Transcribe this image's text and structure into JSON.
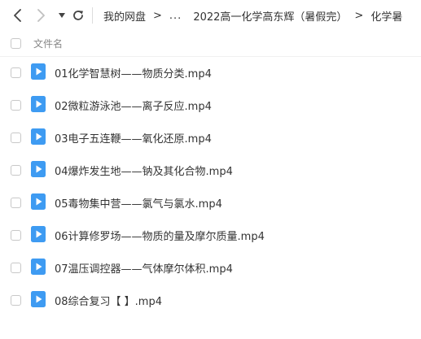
{
  "toolbar": {
    "back_icon": "chevron-left-icon",
    "forward_icon": "chevron-right-icon",
    "history_icon": "caret-down-icon",
    "refresh_icon": "refresh-icon"
  },
  "breadcrumb": {
    "items": [
      "我的网盘",
      "...",
      "2022高一化学高东辉（暑假完）",
      "化学暑"
    ],
    "separator": ">"
  },
  "list_header": {
    "column_name": "文件名"
  },
  "files": [
    {
      "name": "01化学智慧树——物质分类.mp4",
      "icon": "video-file-icon"
    },
    {
      "name": "02微粒游泳池——离子反应.mp4",
      "icon": "video-file-icon"
    },
    {
      "name": "03电子五连鞭——氧化还原.mp4",
      "icon": "video-file-icon"
    },
    {
      "name": "04爆炸发生地——钠及其化合物.mp4",
      "icon": "video-file-icon"
    },
    {
      "name": "05毒物集中营——氯气与氯水.mp4",
      "icon": "video-file-icon"
    },
    {
      "name": "06计算修罗场——物质的量及摩尔质量.mp4",
      "icon": "video-file-icon"
    },
    {
      "name": "07温压调控器——气体摩尔体积.mp4",
      "icon": "video-file-icon"
    },
    {
      "name": "08综合复习【 】.mp4",
      "icon": "video-file-icon"
    }
  ],
  "colors": {
    "video_icon": "#3e9bf2",
    "text": "#333333",
    "muted": "#888888",
    "nav_disabled": "#c0c0c0"
  }
}
